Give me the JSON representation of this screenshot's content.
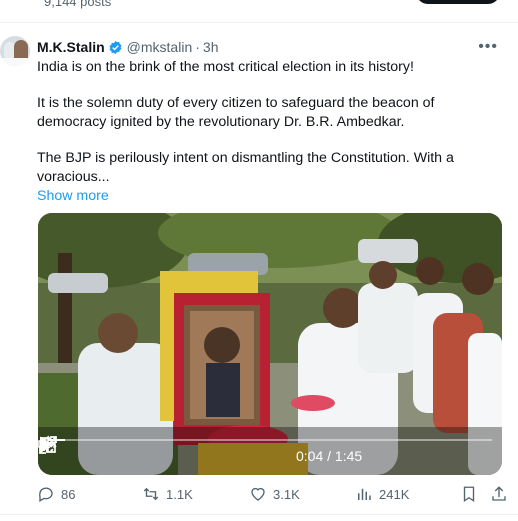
{
  "profile_header": {
    "posts_count": "9,144 posts"
  },
  "tweet": {
    "author_name": "M.K.Stalin",
    "handle": "@mkstalin",
    "separator": "·",
    "time": "3h",
    "more_label": "•••",
    "paragraphs": [
      "India is on the brink of the most critical election in its history!",
      "It is the solemn duty of every citizen to safeguard the beacon of democracy ignited by the revolutionary Dr. B.R. Ambedkar.",
      "The BJP is perilously intent on dismantling the Constitution. With a voracious..."
    ],
    "show_more": "Show more",
    "video": {
      "current_time": "0:04",
      "duration": "1:45",
      "timecode": "0:04 / 1:45",
      "progress_fraction": 0.038
    },
    "stats": {
      "replies": "86",
      "reposts": "1.1K",
      "likes": "3.1K",
      "views": "241K"
    },
    "colors": {
      "accent": "#1d9bf0",
      "muted": "#536471",
      "text": "#0f1419"
    }
  }
}
